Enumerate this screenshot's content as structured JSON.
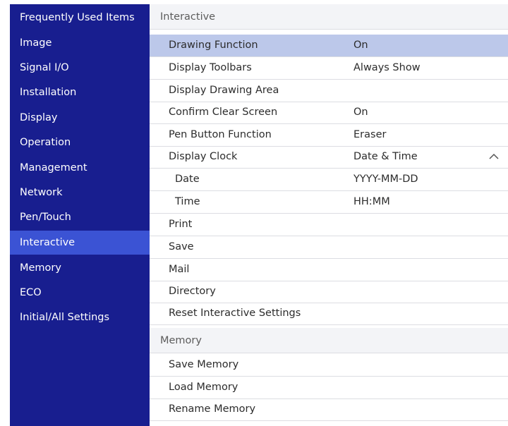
{
  "sidebar": {
    "items": [
      {
        "label": "Frequently Used Items"
      },
      {
        "label": "Image"
      },
      {
        "label": "Signal I/O"
      },
      {
        "label": "Installation"
      },
      {
        "label": "Display"
      },
      {
        "label": "Operation"
      },
      {
        "label": "Management"
      },
      {
        "label": "Network"
      },
      {
        "label": "Pen/Touch"
      },
      {
        "label": "Interactive"
      },
      {
        "label": "Memory"
      },
      {
        "label": "ECO"
      },
      {
        "label": "Initial/All Settings"
      }
    ],
    "active": "Interactive"
  },
  "main": {
    "interactive": {
      "header": "Interactive",
      "rows": [
        {
          "label": "Drawing Function",
          "value": "On"
        },
        {
          "label": "Display Toolbars",
          "value": "Always Show"
        },
        {
          "label": "Display Drawing Area",
          "value": ""
        },
        {
          "label": "Confirm Clear Screen",
          "value": "On"
        },
        {
          "label": "Pen Button Function",
          "value": "Eraser"
        },
        {
          "label": "Display Clock",
          "value": "Date & Time",
          "icon": "chevron-up-icon"
        },
        {
          "label": "Date",
          "value": "YYYY-MM-DD"
        },
        {
          "label": "Time",
          "value": "HH:MM"
        },
        {
          "label": "Print",
          "value": ""
        },
        {
          "label": "Save",
          "value": ""
        },
        {
          "label": "Mail",
          "value": ""
        },
        {
          "label": "Directory",
          "value": ""
        },
        {
          "label": "Reset Interactive Settings",
          "value": ""
        }
      ]
    },
    "memory": {
      "header": "Memory",
      "rows": [
        {
          "label": "Save Memory"
        },
        {
          "label": "Load Memory"
        },
        {
          "label": "Rename Memory"
        }
      ]
    }
  },
  "colors": {
    "sidebar_bg": "#181e8f",
    "sidebar_active": "#3b53d4",
    "row_selected": "#bcc8ea",
    "section_header_bg": "#f3f4f7"
  }
}
